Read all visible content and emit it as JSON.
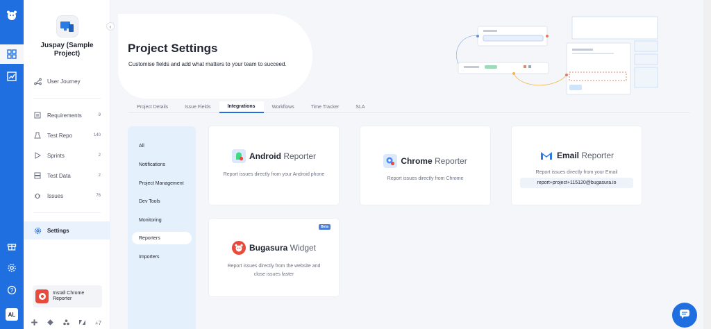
{
  "rail": {
    "user_initials": "AL"
  },
  "sidebar": {
    "project_name": "Juspay (Sample Project)",
    "user_journey": "User Journey",
    "items": [
      {
        "label": "Requirements",
        "count": "9",
        "icon": "requirements-icon"
      },
      {
        "label": "Test Repo",
        "count": "140",
        "icon": "test-repo-icon"
      },
      {
        "label": "Sprints",
        "count": "2",
        "icon": "sprints-icon"
      },
      {
        "label": "Test Data",
        "count": "2",
        "icon": "test-data-icon"
      },
      {
        "label": "Issues",
        "count": "76",
        "icon": "bug-icon"
      }
    ],
    "settings": "Settings",
    "install_chrome": "Install Chrome Reporter",
    "integrations_more": "+7"
  },
  "header": {
    "title": "Project Settings",
    "subtitle": "Customise fields and add what matters to your team to succeed."
  },
  "tabs": [
    "Project Details",
    "Issue Fields",
    "Integrations",
    "Workflows",
    "Time Tracker",
    "SLA"
  ],
  "active_tab": "Integrations",
  "submenu": [
    "All",
    "Notifications",
    "Project Management",
    "Dev Tools",
    "Monitoring",
    "Reporters",
    "Importers"
  ],
  "active_submenu": "Reporters",
  "cards": {
    "android": {
      "bold": "Android",
      "light": "Reporter",
      "desc": "Report issues directly from your Android phone"
    },
    "chrome": {
      "bold": "Chrome",
      "light": "Reporter",
      "desc": "Report issues directly from Chrome"
    },
    "email": {
      "bold": "Email",
      "light": "Reporter",
      "desc": "Report issues directly from your Email",
      "address": "report+project+115120@bugasura.io"
    },
    "widget": {
      "bold": "Bugasura",
      "light": "Widget",
      "desc": "Report issues directly from the website and close issues faster",
      "badge": "Beta"
    }
  },
  "colors": {
    "brand": "#1f6fe0",
    "submenu_bg": "#e4f0fc",
    "bugasura_red": "#e84b3c"
  }
}
